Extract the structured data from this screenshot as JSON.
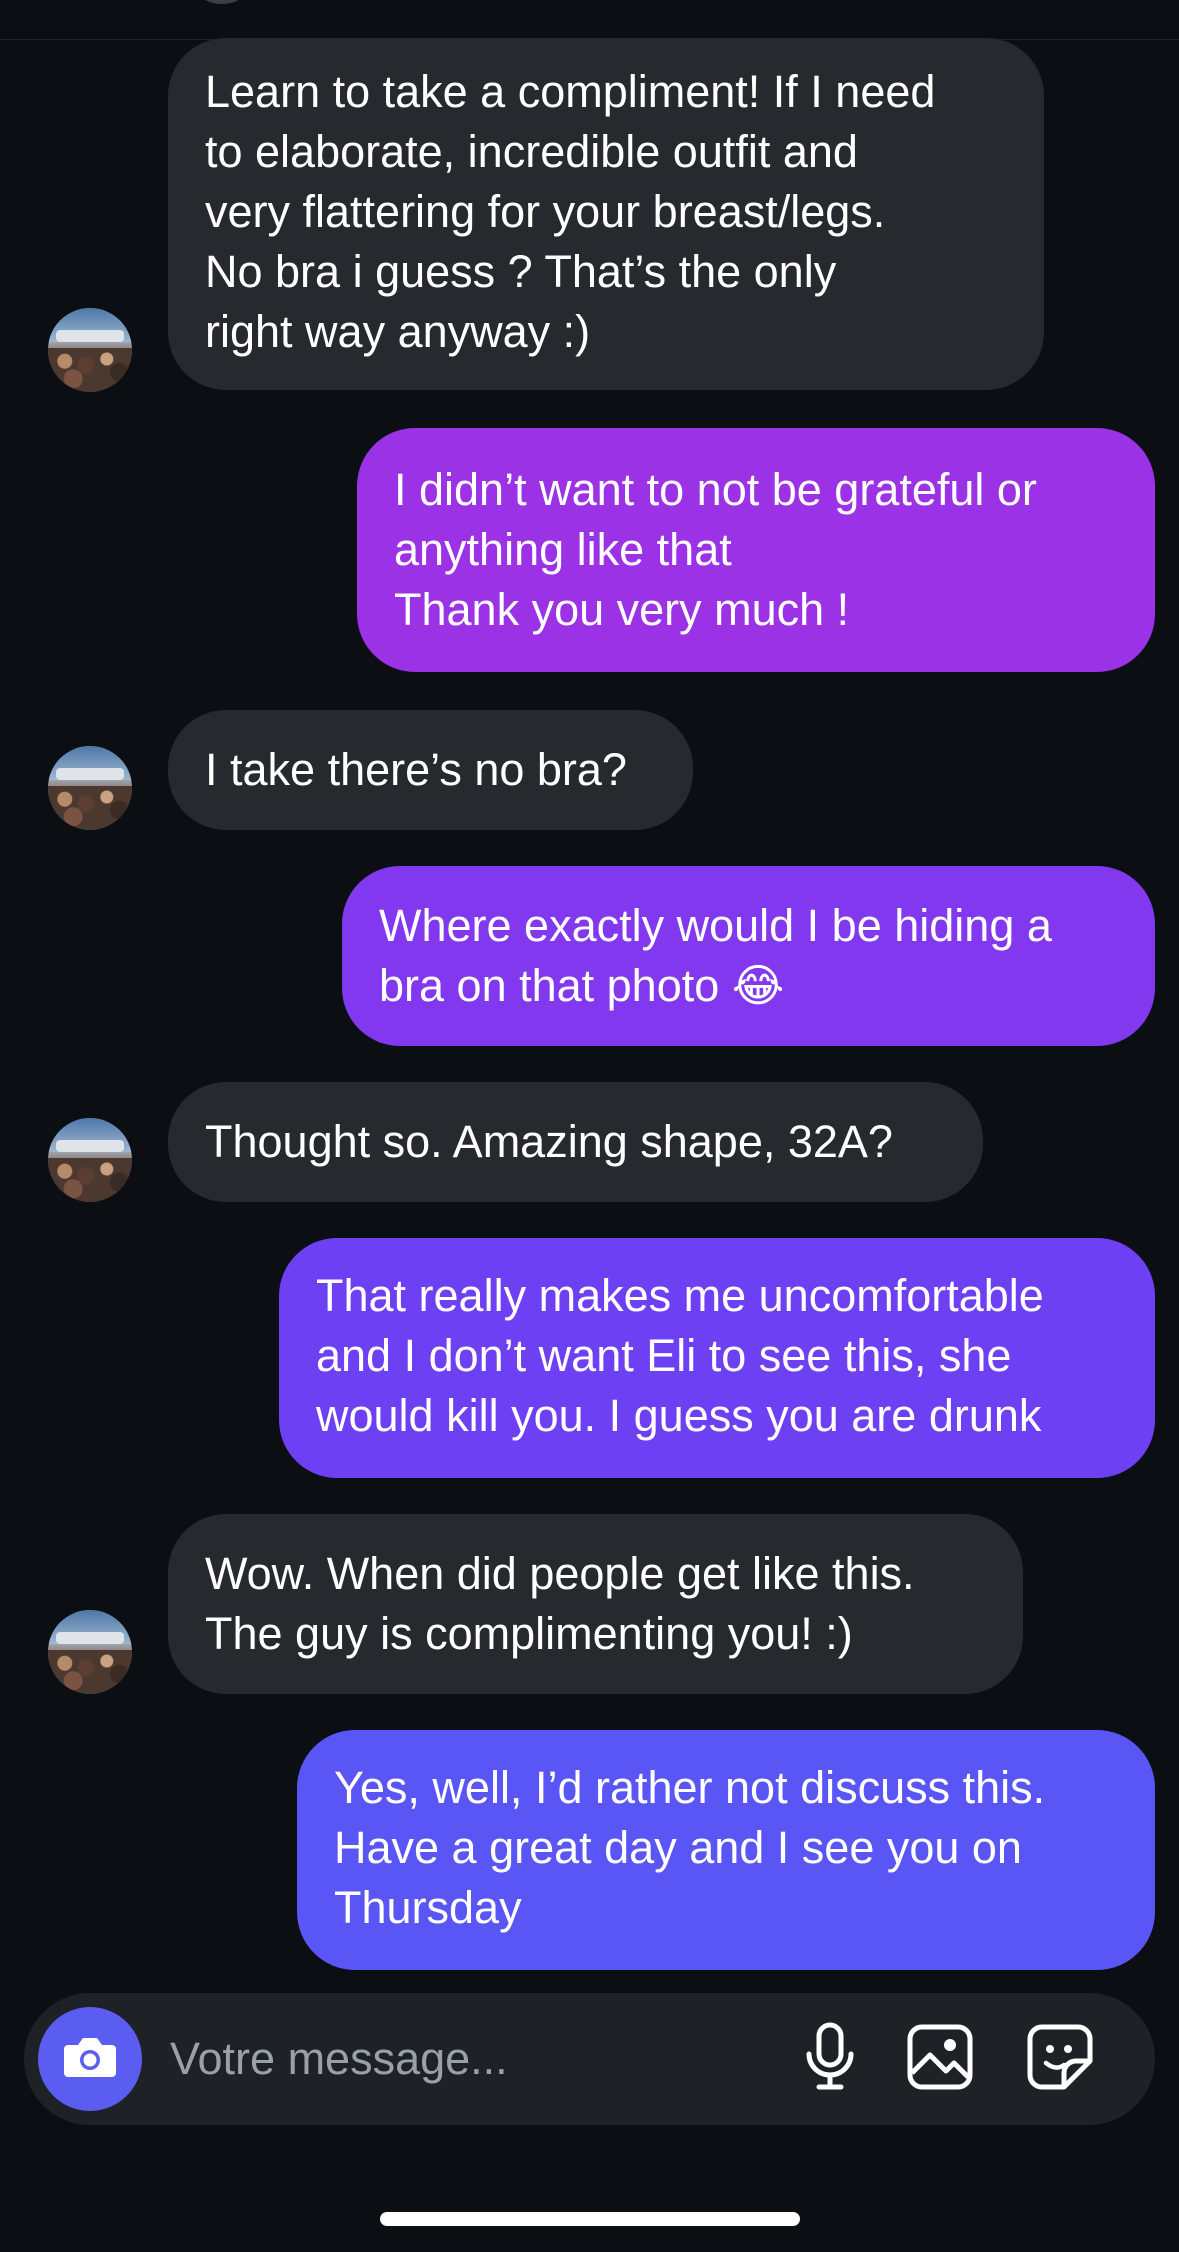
{
  "thread": {
    "messages": [
      {
        "id": 1,
        "direction": "incoming",
        "text": "Learn to take a compliment! If I need\nto elaborate, incredible outfit and\nvery flattering for your breast/legs.\nNo bra i guess ? That’s the only\nright way anyway :)"
      },
      {
        "id": 2,
        "direction": "outgoing",
        "text": "I didn’t want to not be grateful or\nanything like that\nThank you very much !"
      },
      {
        "id": 3,
        "direction": "incoming",
        "text": "I take there’s no bra?"
      },
      {
        "id": 4,
        "direction": "outgoing",
        "text": "Where exactly would I be hiding a\nbra on that photo 😂"
      },
      {
        "id": 5,
        "direction": "incoming",
        "text": "Thought so. Amazing shape, 32A?"
      },
      {
        "id": 6,
        "direction": "outgoing",
        "text": "That really makes me uncomfortable\nand I don’t want Eli to see this, she\nwould kill you. I guess you are drunk"
      },
      {
        "id": 7,
        "direction": "incoming",
        "text": "Wow. When did people get like this.\nThe guy is complimenting you! :)"
      },
      {
        "id": 8,
        "direction": "outgoing",
        "text": "Yes, well, I’d rather not discuss this.\nHave a great day and I see you on\nThursday"
      }
    ]
  },
  "composer": {
    "placeholder": "Votre message...",
    "icons": [
      "camera-icon",
      "microphone-icon",
      "gallery-icon",
      "sticker-icon"
    ]
  },
  "colors": {
    "background": "#0b0e13",
    "incoming_bubble": "#26292e",
    "outgoing_gradient_top": "#9b30e6",
    "outgoing_gradient_bottom": "#5a55f5",
    "camera_button": "#5b5cf0"
  }
}
